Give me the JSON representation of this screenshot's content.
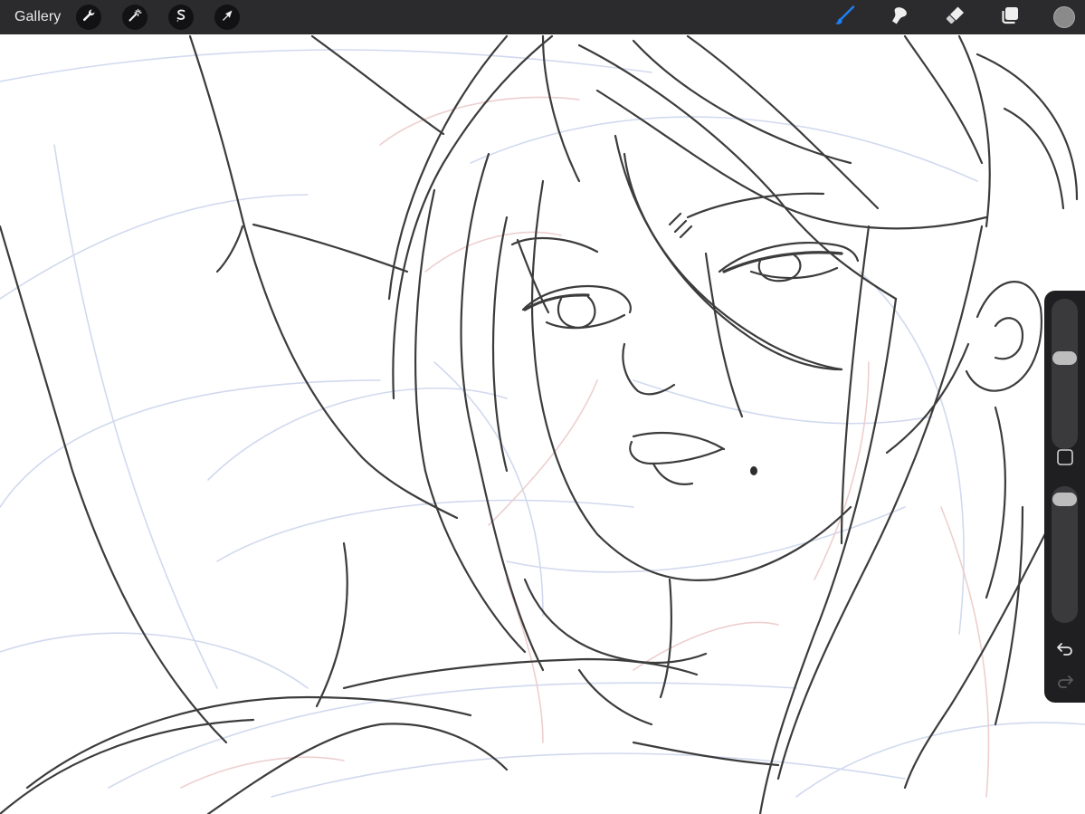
{
  "toolbar": {
    "gallery_label": "Gallery",
    "left_tools": [
      {
        "name": "actions",
        "icon": "wrench-icon"
      },
      {
        "name": "adjustments",
        "icon": "magic-wand-icon"
      },
      {
        "name": "selection",
        "icon": "selection-s-icon"
      },
      {
        "name": "transform",
        "icon": "arrow-cursor-icon"
      }
    ],
    "right_tools": [
      {
        "name": "brush",
        "icon": "brush-icon",
        "active": true
      },
      {
        "name": "smudge",
        "icon": "smudge-icon",
        "active": false
      },
      {
        "name": "eraser",
        "icon": "eraser-icon",
        "active": false
      },
      {
        "name": "layers",
        "icon": "layers-icon",
        "active": false
      }
    ],
    "current_color": "#8a8a8a",
    "active_tool_color": "#1e7ff5"
  },
  "sidebar": {
    "brush_size_level": 0.62,
    "opacity_level": 0.96,
    "modify_icon": "square-icon",
    "undo_icon": "undo-arrow-icon",
    "redo_icon": "redo-arrow-icon",
    "redo_enabled": false
  },
  "canvas": {
    "content": "pencil-sketch-anime-woman",
    "line_color": "#3c3c3c"
  }
}
